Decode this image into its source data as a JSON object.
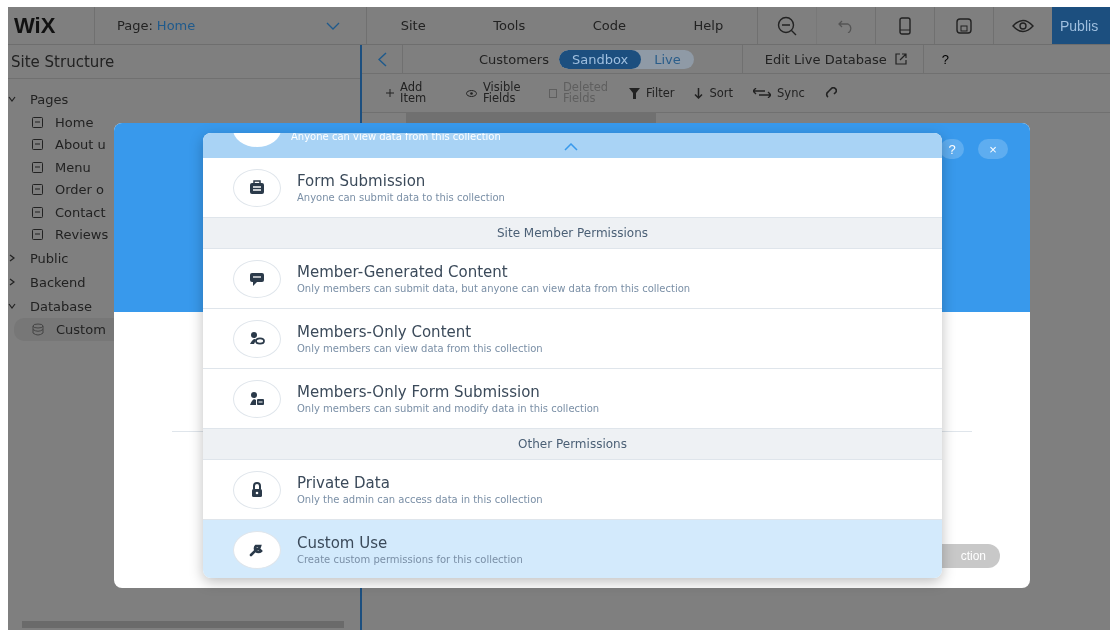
{
  "topbar": {
    "logo": "WiX",
    "page_label": "Page:",
    "page_name": "Home",
    "menus": [
      "Site",
      "Tools",
      "Code",
      "Help"
    ],
    "undo_disabled": true,
    "publish": "Publis"
  },
  "sidebar": {
    "title": "Site Structure",
    "groups": [
      {
        "label": "Pages",
        "expanded": true,
        "children": [
          {
            "label": "Home"
          },
          {
            "label": "About u"
          },
          {
            "label": "Menu"
          },
          {
            "label": "Order o"
          },
          {
            "label": "Contact"
          },
          {
            "label": "Reviews"
          }
        ]
      },
      {
        "label": "Public",
        "expanded": false
      },
      {
        "label": "Backend",
        "expanded": false
      },
      {
        "label": "Database",
        "expanded": true,
        "children": [
          {
            "label": "Custom",
            "selected": true
          }
        ]
      }
    ]
  },
  "database": {
    "collection": "Customers",
    "modes": [
      {
        "label": "Sandbox",
        "selected": true
      },
      {
        "label": "Live",
        "selected": false
      }
    ],
    "edit_live": "Edit Live Database",
    "help": "?",
    "tools": [
      {
        "kind": "add",
        "label": "Add Item",
        "disabled": false
      },
      {
        "kind": "visible",
        "label": "Visible Fields",
        "disabled": false
      },
      {
        "kind": "deleted",
        "label": "Deleted Fields",
        "disabled": true
      },
      {
        "kind": "filter",
        "label": "Filter",
        "disabled": false
      },
      {
        "kind": "sort",
        "label": "Sort",
        "disabled": false
      },
      {
        "kind": "sync",
        "label": "Sync",
        "disabled": false
      }
    ]
  },
  "modal": {
    "help": "?",
    "close": "×",
    "button": "ction"
  },
  "dropdown": {
    "partial_description": "Anyone can view data from this collection",
    "items": [
      {
        "kind": "option",
        "title": "Form Submission",
        "description": "Anyone can submit data to this collection",
        "selected": false
      },
      {
        "kind": "header",
        "label": "Site Member Permissions"
      },
      {
        "kind": "option",
        "title": "Member-Generated Content",
        "description": "Only members can submit data, but anyone can view data from this collection",
        "selected": false
      },
      {
        "kind": "option",
        "title": "Members-Only Content",
        "description": "Only members can view data from this collection",
        "selected": false
      },
      {
        "kind": "option",
        "title": "Members-Only Form Submission",
        "description": "Only members can submit and modify data in this collection",
        "selected": false
      },
      {
        "kind": "header",
        "label": "Other Permissions"
      },
      {
        "kind": "option",
        "title": "Private Data",
        "description": "Only the admin can access data in this collection",
        "selected": false
      },
      {
        "kind": "option",
        "title": "Custom Use",
        "description": "Create custom permissions for this collection",
        "selected": true
      }
    ]
  }
}
